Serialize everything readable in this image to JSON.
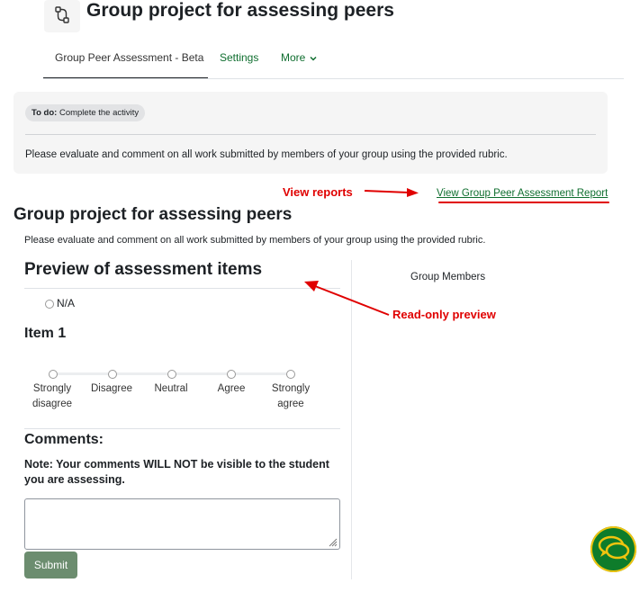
{
  "header": {
    "title": "Group project for assessing peers"
  },
  "tabs": [
    {
      "label": "Group Peer Assessment - Beta",
      "active": true
    },
    {
      "label": "Settings"
    },
    {
      "label": "More"
    }
  ],
  "activity": {
    "todo_label": "To do:",
    "todo_text": "Complete the activity",
    "intro": "Please evaluate and comment on all work submitted by members of your group using the provided rubric."
  },
  "annotations": {
    "view_reports": "View reports",
    "read_only_preview": "Read-only preview"
  },
  "report_link": "View Group Peer Assessment Report",
  "main": {
    "heading": "Group project for assessing peers",
    "description": "Please evaluate and comment on all work submitted by members of your group using the provided rubric."
  },
  "preview": {
    "heading": "Preview of assessment items",
    "na_label": "N/A",
    "item_heading": "Item 1",
    "scale": [
      {
        "line1": "Strongly",
        "line2": "disagree"
      },
      {
        "line1": "Disagree",
        "line2": ""
      },
      {
        "line1": "Neutral",
        "line2": ""
      },
      {
        "line1": "Agree",
        "line2": ""
      },
      {
        "line1": "Strongly",
        "line2": "agree"
      }
    ],
    "comments_heading": "Comments:",
    "comments_note": "Note: Your comments WILL NOT be visible to the student you are assessing.",
    "submit_label": "Submit"
  },
  "sidebar": {
    "group_members": "Group Members"
  },
  "colors": {
    "accent": "#0f6e2f",
    "annotation": "#e00000",
    "submit": "#6c8d6f",
    "chat": "#0e7c2b"
  },
  "icons": {
    "activity": "workflow-icon",
    "more": "chevron-down-icon",
    "chat": "chat-bubbles-icon"
  }
}
